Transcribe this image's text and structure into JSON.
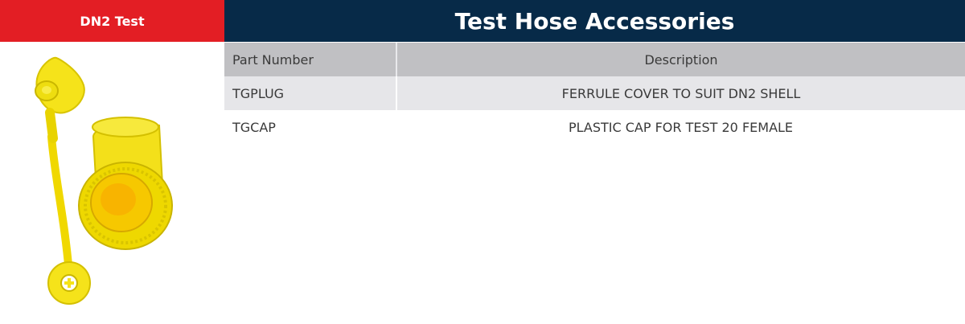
{
  "section_tab": {
    "label": "DN2 Test"
  },
  "header": {
    "title": "Test Hose Accessories"
  },
  "image": {
    "icon": "yellow-plastic-cap-and-plug-photo",
    "color": "#f4e41e"
  },
  "table": {
    "columns": [
      "Part Number",
      "Description"
    ],
    "rows": [
      {
        "part": "TGPLUG",
        "description": "FERRULE COVER TO SUIT DN2 SHELL"
      },
      {
        "part": "TGCAP",
        "description": "PLASTIC CAP FOR TEST 20 FEMALE"
      }
    ]
  },
  "colors": {
    "tab_red": "#e31e24",
    "header_navy": "#072a48",
    "header_gray": "#c0c0c3",
    "row_shade": "#e6e6e9"
  }
}
